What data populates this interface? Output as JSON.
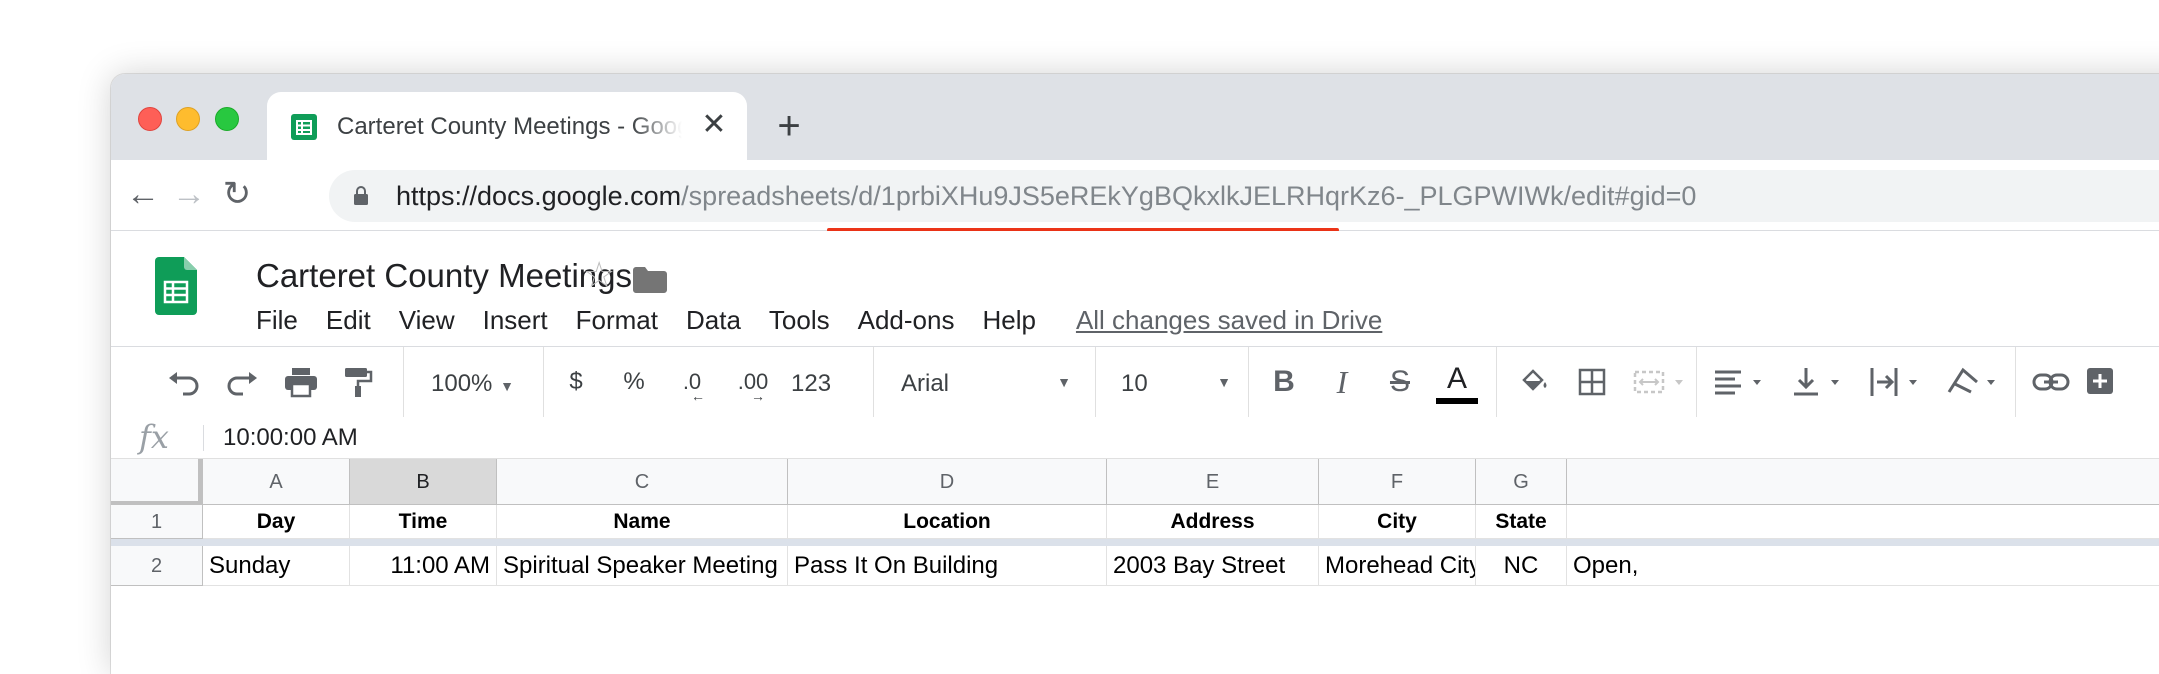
{
  "browser": {
    "tab_title": "Carteret County Meetings - Google Sheets",
    "tab_close": "✕",
    "new_tab": "+",
    "url_host": "https://docs.google.com",
    "url_path": "/spreadsheets/d/1prbiXHu9JS5eREkYgBQkxlkJELRHqrKz6-_PLGPWIWk/edit#gid=0",
    "back": "←",
    "forward": "→",
    "reload": "↻"
  },
  "doc": {
    "title": "Carteret County Meetings",
    "star": "☆",
    "menu": [
      "File",
      "Edit",
      "View",
      "Insert",
      "Format",
      "Data",
      "Tools",
      "Add-ons",
      "Help"
    ],
    "save_status": "All changes saved in Drive"
  },
  "toolbar": {
    "zoom": "100%",
    "currency": "$",
    "percent": "%",
    "decrease_decimal": ".0",
    "increase_decimal": ".00",
    "more_formats": "123",
    "font": "Arial",
    "font_size": "10",
    "bold": "B",
    "italic": "I",
    "strikethrough": "S",
    "text_color_letter": "A",
    "text_color": "#000000"
  },
  "formula_bar": {
    "fx": "fx",
    "value": "10:00:00 AM"
  },
  "sheet": {
    "columns": [
      "A",
      "B",
      "C",
      "D",
      "E",
      "F",
      "G"
    ],
    "selected_column": "B",
    "row_numbers": [
      "1",
      "2"
    ],
    "header_row": [
      "Day",
      "Time",
      "Name",
      "Location",
      "Address",
      "City",
      "State"
    ],
    "data_row": [
      "Sunday",
      "11:00 AM",
      "Spiritual Speaker Meeting",
      "Pass It On Building",
      "2003 Bay Street",
      "Morehead City",
      "NC",
      "Open,"
    ]
  },
  "colors": {
    "sheets_green": "#0f9d58",
    "url_underline": "#ea1f00",
    "selected_header": "#d9d9d9"
  }
}
